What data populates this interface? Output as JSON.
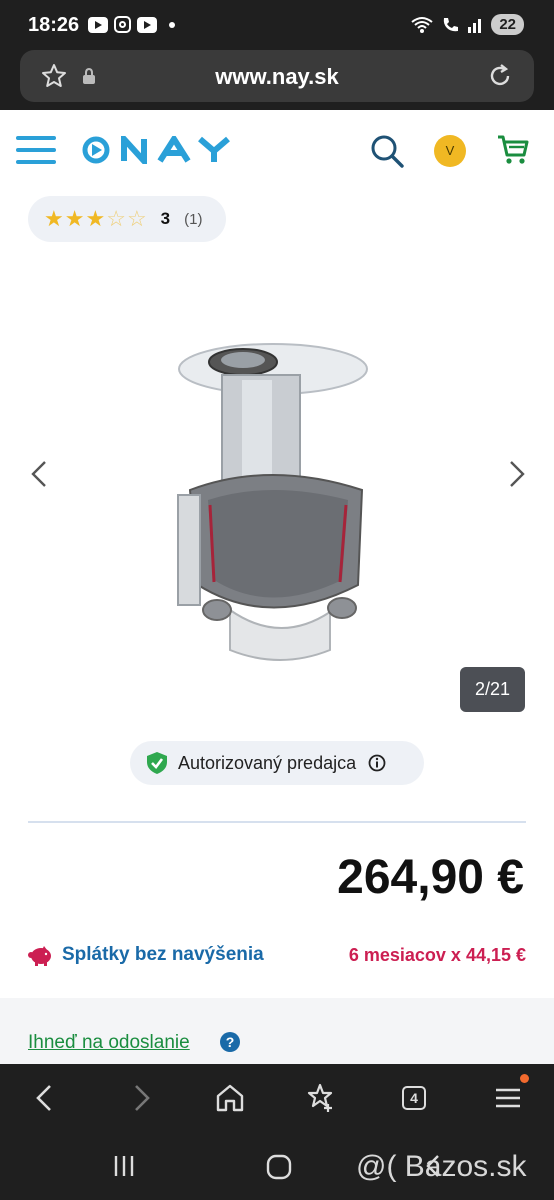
{
  "status_bar": {
    "time": "18:26",
    "battery": "22"
  },
  "browser": {
    "url": "www.nay.sk"
  },
  "header": {
    "logo_text": "NAY",
    "avatar_initial": "V"
  },
  "rating": {
    "stars_filled": 3,
    "stars_total": 5,
    "value": "3",
    "count": "(1)"
  },
  "gallery": {
    "counter": "2/21"
  },
  "seller": {
    "label": "Autorizovaný predajca"
  },
  "price": {
    "value": "264,90 €"
  },
  "installments": {
    "label": "Splátky bez navýšenia",
    "value": "6 mesiacov x 44,15 €"
  },
  "shipping": {
    "link": "Ihneď na odoslanie",
    "help": "?"
  },
  "bottom_nav": {
    "tabs_count": "4"
  },
  "watermark": {
    "text": "@( Bazos.sk"
  },
  "colors": {
    "brand_blue": "#2aa0d8",
    "price_pink": "#cc1f52",
    "link_green": "#1a8d3f",
    "star_yellow": "#f0b823"
  }
}
